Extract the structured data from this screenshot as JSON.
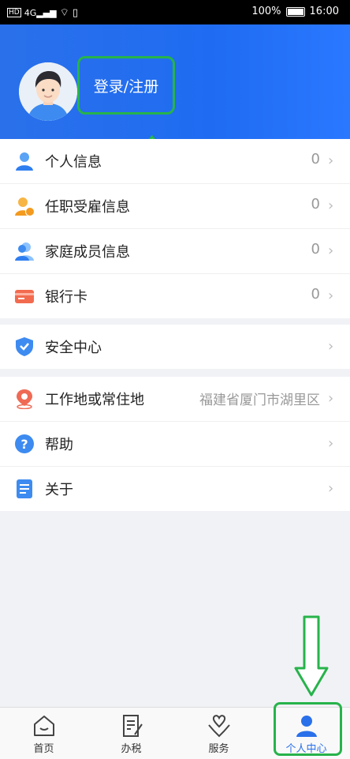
{
  "status_bar": {
    "time": "16:00",
    "battery": "100%"
  },
  "header": {
    "login_label": "登录/注册"
  },
  "section1": [
    {
      "label": "个人信息",
      "value": "0"
    },
    {
      "label": "任职受雇信息",
      "value": "0"
    },
    {
      "label": "家庭成员信息",
      "value": "0"
    },
    {
      "label": "银行卡",
      "value": "0"
    }
  ],
  "section2": [
    {
      "label": "安全中心"
    }
  ],
  "section3": [
    {
      "label": "工作地或常住地",
      "value": "福建省厦门市湖里区"
    },
    {
      "label": "帮助"
    },
    {
      "label": "关于"
    }
  ],
  "tabbar": [
    {
      "label": "首页"
    },
    {
      "label": "办税"
    },
    {
      "label": "服务"
    },
    {
      "label": "个人中心"
    }
  ],
  "colors": {
    "accent": "#2a70ea",
    "highlight": "#27b34b"
  }
}
